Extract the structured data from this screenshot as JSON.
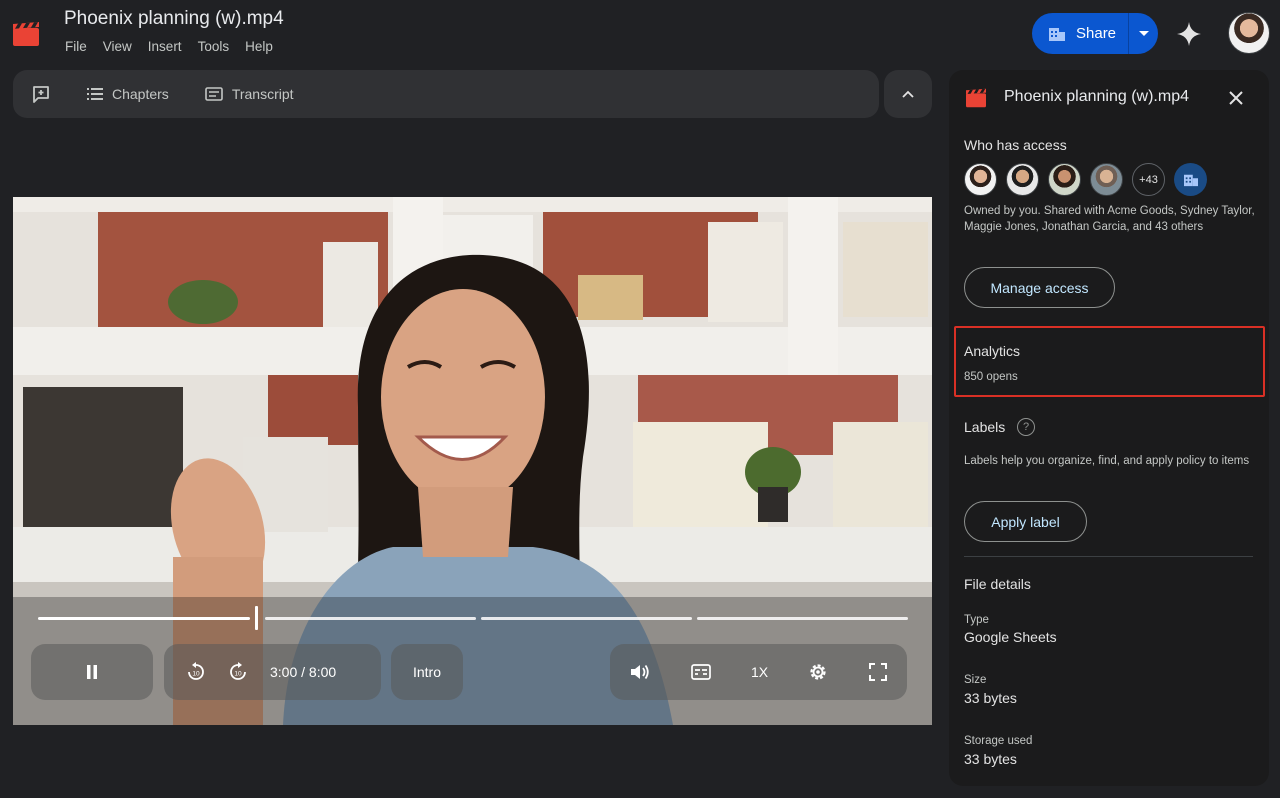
{
  "app": {
    "doc_title": "Phoenix planning (w).mp4",
    "menu": [
      "File",
      "View",
      "Insert",
      "Tools",
      "Help"
    ],
    "share_label": "Share"
  },
  "toolbar": {
    "chapters_label": "Chapters",
    "transcript_label": "Transcript"
  },
  "player": {
    "time": "3:00 / 8:00",
    "chapter": "Intro",
    "speed": "1X",
    "progress_fraction": 0.375
  },
  "panel": {
    "title": "Phoenix planning (w).mp4",
    "who_has_access_heading": "Who has access",
    "more_count": "+43",
    "owner_text": "Owned by you. Shared with Acme Goods, Sydney Taylor, Maggie Jones, Jonathan Garcia, and 43 others",
    "manage_access_label": "Manage access",
    "analytics_heading": "Analytics",
    "analytics_value": "850 opens",
    "labels_heading": "Labels",
    "labels_help": "?",
    "labels_desc": "Labels help you organize, find, and apply policy to items",
    "apply_label": "Apply label",
    "file_details_heading": "File details",
    "type_label": "Type",
    "type_value": "Google Sheets",
    "size_label": "Size",
    "size_value": "33 bytes",
    "storage_label": "Storage used",
    "storage_value": "33 bytes"
  },
  "colors": {
    "accent": "#0b57d0",
    "highlight": "#d93025",
    "app_icon": "#ea4335"
  },
  "icons": [
    "vids-app-icon",
    "drive-shared-icon",
    "caret-down-icon",
    "gemini-sparkle-icon",
    "add-comment-icon",
    "chapters-list-icon",
    "transcript-icon",
    "chevron-up-icon",
    "pause-icon",
    "rewind-10-icon",
    "forward-10-icon",
    "volume-icon",
    "captions-icon",
    "settings-icon",
    "fullscreen-icon",
    "close-icon",
    "help-icon"
  ]
}
